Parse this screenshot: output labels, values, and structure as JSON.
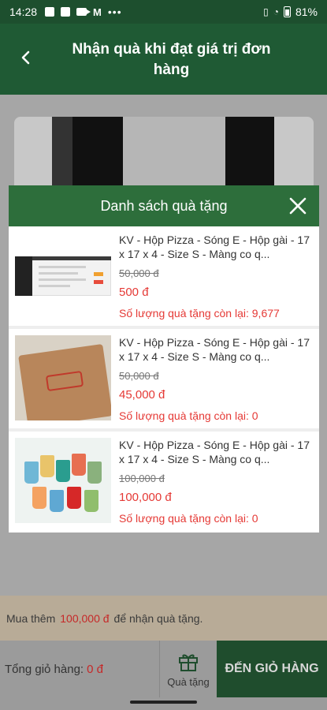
{
  "status_bar": {
    "time": "14:28",
    "battery": "81%"
  },
  "header": {
    "title": "Nhận quà khi đạt giá trị đơn hàng"
  },
  "modal": {
    "title": "Danh sách quà tặng",
    "items": [
      {
        "name": "KV - Hộp Pizza - Sóng E - Hộp gài - 17 x 17 x 4 - Size S - Màng co q...",
        "old_price": "50,000 đ",
        "new_price": "500 đ",
        "remaining": "Số lượng quà tặng còn lại: 9,677"
      },
      {
        "name": "KV - Hộp Pizza - Sóng E - Hộp gài - 17 x 17 x 4 - Size S - Màng co q...",
        "old_price": "50,000 đ",
        "new_price": "45,000 đ",
        "remaining": "Số lượng quà tặng còn lại: 0"
      },
      {
        "name": "KV - Hộp Pizza - Sóng E - Hộp gài - 17 x 17 x 4 - Size S - Màng co q...",
        "old_price": "100,000 đ",
        "new_price": "100,000 đ",
        "remaining": "Số lượng quà tặng còn lại: 0"
      }
    ]
  },
  "promo": {
    "prefix": "Mua thêm",
    "amount": "100,000 đ",
    "suffix": "để nhận quà tặng."
  },
  "footer": {
    "total_label": "Tổng giỏ hàng:",
    "total_value": "0 đ",
    "gift_label": "Quà tặng",
    "cart_label": "ĐẾN GIỎ HÀNG"
  },
  "colors": {
    "primary": "#2d6e3b",
    "header": "#1f5a34",
    "price_red": "#e53935"
  }
}
